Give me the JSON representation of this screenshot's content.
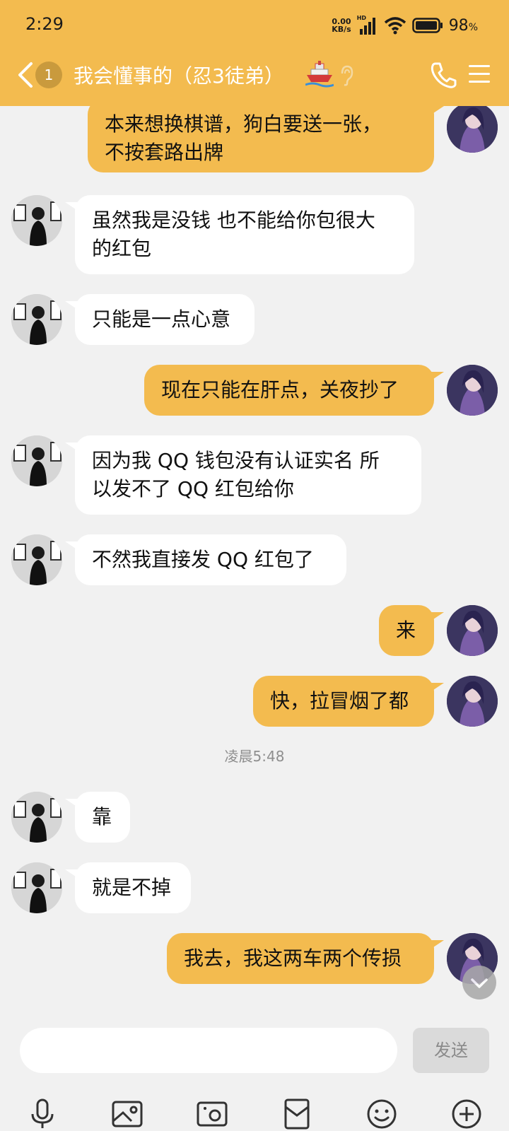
{
  "status_bar": {
    "time": "2:29",
    "net_speed_value": "0.00",
    "net_speed_unit": "KB/s",
    "hd_label": "HD",
    "battery_percent": "98",
    "battery_unit": "%"
  },
  "header": {
    "unread_count": "1",
    "title": "我会懂事的（忍3徒弟）"
  },
  "messages": [
    {
      "side": "me",
      "text": "本来想换棋谱，狗白要送一张，\n不按套路出牌"
    },
    {
      "side": "other",
      "text": "虽然我是没钱 也不能给你包很大\n的红包"
    },
    {
      "side": "other",
      "text": "只能是一点心意"
    },
    {
      "side": "me",
      "text": "现在只能在肝点，关夜抄了"
    },
    {
      "side": "other",
      "text": "因为我 QQ 钱包没有认证实名 所\n以发不了 QQ 红包给你"
    },
    {
      "side": "other",
      "text": "不然我直接发 QQ 红包了"
    },
    {
      "side": "me",
      "text": "来"
    },
    {
      "side": "me",
      "text": "快，拉冒烟了都"
    },
    {
      "side": "other",
      "text": "靠"
    },
    {
      "side": "other",
      "text": "就是不掉"
    },
    {
      "side": "me",
      "text": "我去，我这两车两个传损"
    }
  ],
  "timestamp": "凌晨5:48",
  "input": {
    "placeholder": "",
    "send_label": "发送"
  },
  "toolbar_icons": [
    "microphone-icon",
    "image-icon",
    "camera-icon",
    "red-packet-icon",
    "emoji-icon",
    "plus-icon"
  ],
  "colors": {
    "accent": "#f3bb4f",
    "background": "#f1f1f1",
    "other_bubble": "#ffffff",
    "send_disabled": "#dadada"
  }
}
